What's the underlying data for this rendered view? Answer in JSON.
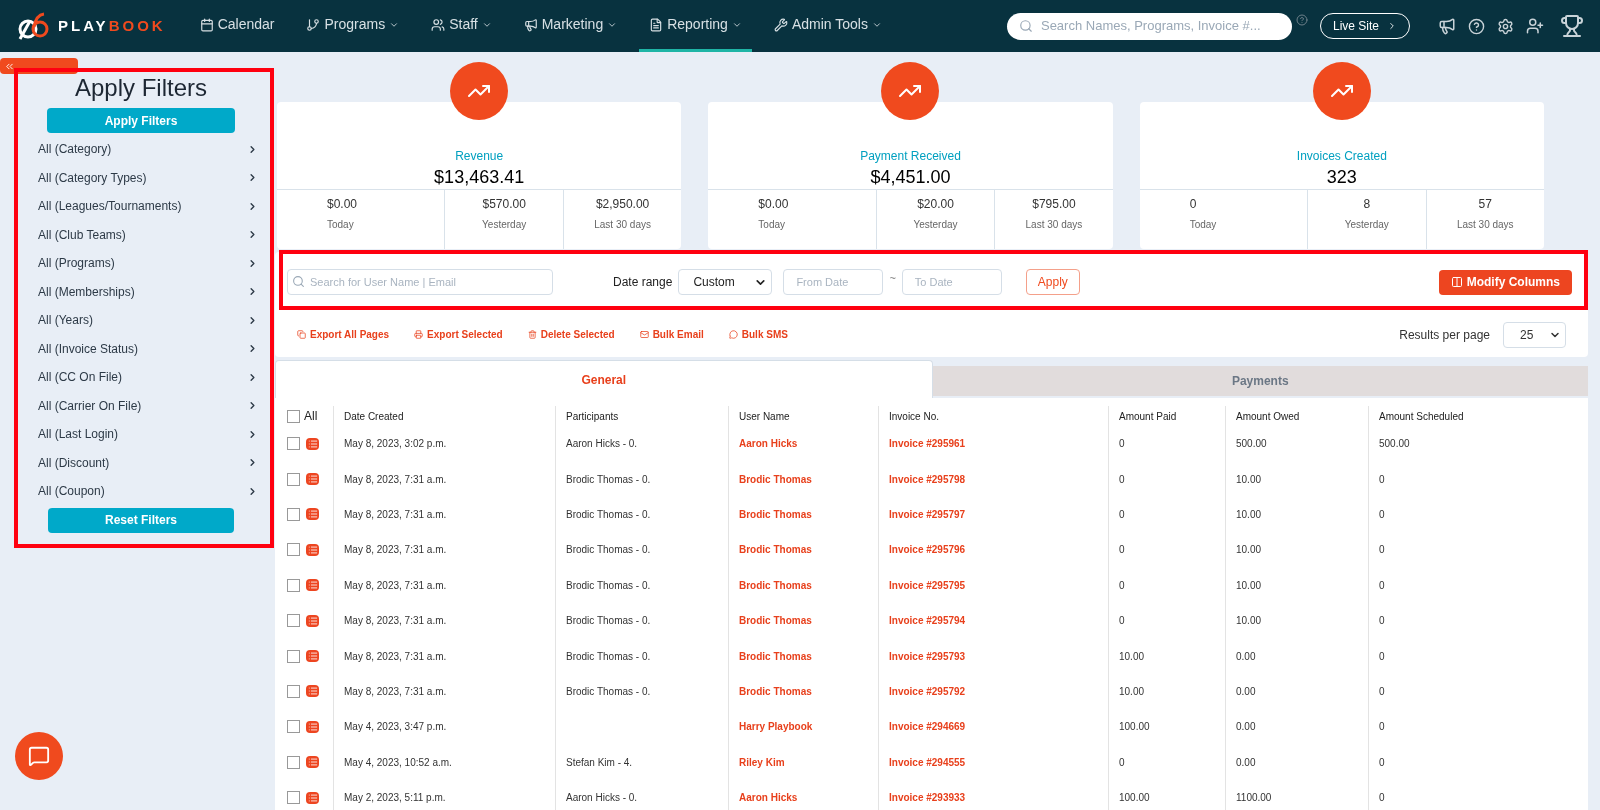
{
  "nav": {
    "brand": "PLAYBOOK",
    "items": [
      {
        "label": "Calendar",
        "kind": "calendar",
        "dropdown": false,
        "selected": false
      },
      {
        "label": "Programs",
        "kind": "branch",
        "dropdown": true,
        "selected": false
      },
      {
        "label": "Staff",
        "kind": "users",
        "dropdown": true,
        "selected": false
      },
      {
        "label": "Marketing",
        "kind": "megaphone",
        "dropdown": true,
        "selected": false
      },
      {
        "label": "Reporting",
        "kind": "file",
        "dropdown": true,
        "selected": true
      },
      {
        "label": "Admin Tools",
        "kind": "tools",
        "dropdown": true,
        "selected": false
      }
    ],
    "search": {
      "placeholder": "Search Names, Programs, Invoice #..."
    },
    "live_site": "Live Site"
  },
  "sidebar": {
    "title": "Apply Filters",
    "apply": "Apply Filters",
    "reset": "Reset Filters",
    "filters": [
      "All (Category)",
      "All (Category Types)",
      "All (Leagues/Tournaments)",
      "All (Club Teams)",
      "All (Programs)",
      "All (Memberships)",
      "All (Years)",
      "All (Invoice Status)",
      "All (CC On File)",
      "All (Carrier On File)",
      "All (Last Login)",
      "All (Discount)",
      "All (Coupon)"
    ]
  },
  "cards": [
    {
      "title": "Revenue",
      "total": "$13,463.41",
      "stats": [
        {
          "value": "$0.00",
          "label": "Today"
        },
        {
          "value": "$570.00",
          "label": "Yesterday"
        },
        {
          "value": "$2,950.00",
          "label": "Last 30 days"
        }
      ]
    },
    {
      "title": "Payment Received",
      "total": "$4,451.00",
      "stats": [
        {
          "value": "$0.00",
          "label": "Today"
        },
        {
          "value": "$20.00",
          "label": "Yesterday"
        },
        {
          "value": "$795.00",
          "label": "Last 30 days"
        }
      ]
    },
    {
      "title": "Invoices Created",
      "total": "323",
      "stats": [
        {
          "value": "0",
          "label": "Today"
        },
        {
          "value": "8",
          "label": "Yesterday"
        },
        {
          "value": "57",
          "label": "Last 30 days"
        }
      ]
    }
  ],
  "filter_bar": {
    "search_placeholder": "Search for User Name | Email",
    "date_range_label": "Date range",
    "date_range": "Custom",
    "from_placeholder": "From Date",
    "separator": "~",
    "to_placeholder": "To Date",
    "apply": "Apply",
    "modify_columns": "Modify Columns"
  },
  "actions": [
    {
      "label": "Export All Pages",
      "kind": "copy"
    },
    {
      "label": "Export Selected",
      "kind": "print"
    },
    {
      "label": "Delete Selected",
      "kind": "trash"
    },
    {
      "label": "Bulk Email",
      "kind": "mail"
    },
    {
      "label": "Bulk SMS",
      "kind": "chat"
    }
  ],
  "results_per_page": {
    "label": "Results per page",
    "value": "25"
  },
  "tabs": [
    {
      "label": "General",
      "selected": true
    },
    {
      "label": "Payments",
      "selected": false
    }
  ],
  "table": {
    "select_all": "All",
    "select_all_checked": false,
    "columns": [
      "Date Created",
      "Participants",
      "User Name",
      "Invoice No.",
      "Amount Paid",
      "Amount Owed",
      "Amount Scheduled"
    ],
    "rows": [
      {
        "checked": false,
        "cells": [
          "May 8, 2023, 3:02 p.m.",
          "Aaron Hicks - 0.",
          "Aaron Hicks",
          "Invoice #295961",
          "0",
          "500.00",
          "500.00"
        ]
      },
      {
        "checked": false,
        "cells": [
          "May 8, 2023, 7:31 a.m.",
          "Brodic Thomas - 0.",
          "Brodic Thomas",
          "Invoice #295798",
          "0",
          "10.00",
          "0"
        ]
      },
      {
        "checked": false,
        "cells": [
          "May 8, 2023, 7:31 a.m.",
          "Brodic Thomas - 0.",
          "Brodic Thomas",
          "Invoice #295797",
          "0",
          "10.00",
          "0"
        ]
      },
      {
        "checked": false,
        "cells": [
          "May 8, 2023, 7:31 a.m.",
          "Brodic Thomas - 0.",
          "Brodic Thomas",
          "Invoice #295796",
          "0",
          "10.00",
          "0"
        ]
      },
      {
        "checked": false,
        "cells": [
          "May 8, 2023, 7:31 a.m.",
          "Brodic Thomas - 0.",
          "Brodic Thomas",
          "Invoice #295795",
          "0",
          "10.00",
          "0"
        ]
      },
      {
        "checked": false,
        "cells": [
          "May 8, 2023, 7:31 a.m.",
          "Brodic Thomas - 0.",
          "Brodic Thomas",
          "Invoice #295794",
          "0",
          "10.00",
          "0"
        ]
      },
      {
        "checked": false,
        "cells": [
          "May 8, 2023, 7:31 a.m.",
          "Brodic Thomas - 0.",
          "Brodic Thomas",
          "Invoice #295793",
          "10.00",
          "0.00",
          "0"
        ]
      },
      {
        "checked": false,
        "cells": [
          "May 8, 2023, 7:31 a.m.",
          "Brodic Thomas - 0.",
          "Brodic Thomas",
          "Invoice #295792",
          "10.00",
          "0.00",
          "0"
        ]
      },
      {
        "checked": false,
        "cells": [
          "May 4, 2023, 3:47 p.m.",
          "",
          "Harry Playbook",
          "Invoice #294669",
          "100.00",
          "0.00",
          "0"
        ]
      },
      {
        "checked": false,
        "cells": [
          "May 4, 2023, 10:52 a.m.",
          "Stefan Kim - 4.",
          "Riley Kim",
          "Invoice #294555",
          "0",
          "0.00",
          "0"
        ]
      },
      {
        "checked": false,
        "cells": [
          "May 2, 2023, 5:11 p.m.",
          "Aaron Hicks - 0.",
          "Aaron Hicks",
          "Invoice #293933",
          "100.00",
          "1100.00",
          "0"
        ]
      }
    ]
  }
}
